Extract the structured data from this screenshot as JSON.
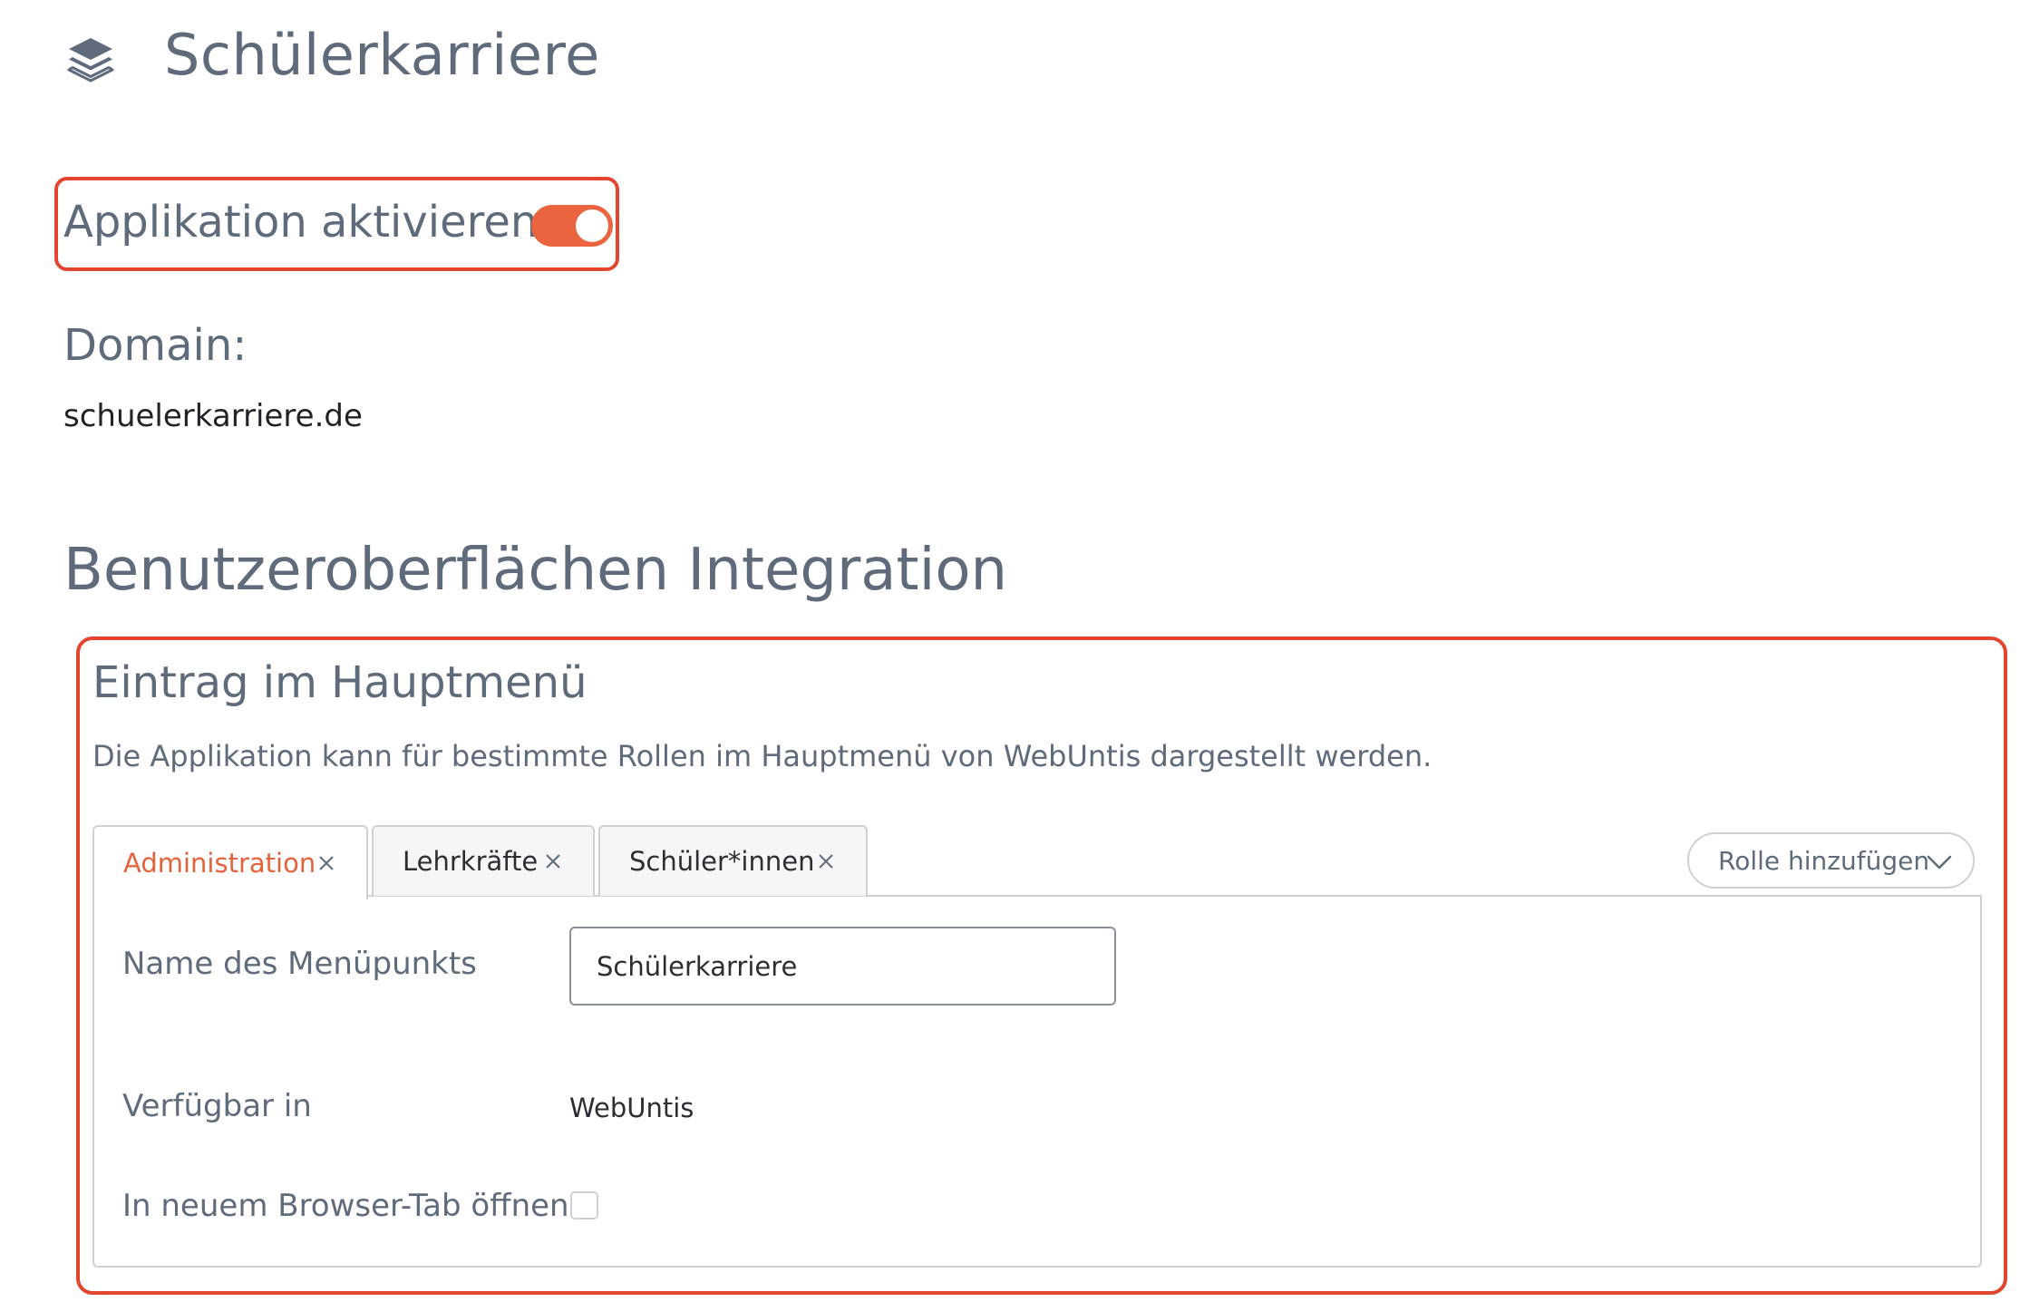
{
  "header": {
    "icon": "layers-icon",
    "title": "Schülerkarriere"
  },
  "activation": {
    "label": "Applikation aktivieren",
    "enabled": true,
    "accent_color": "#ea6440"
  },
  "domain": {
    "label": "Domain:",
    "value": "schuelerkarriere.de"
  },
  "integration": {
    "heading": "Benutzeroberflächen Integration",
    "menu_entry": {
      "title": "Eintrag im Hauptmenü",
      "description": "Die Applikation kann für bestimmte Rollen im Hauptmenü von WebUntis dargestellt werden.",
      "tabs": [
        {
          "label": "Administration",
          "active": true
        },
        {
          "label": "Lehrkräfte",
          "active": false
        },
        {
          "label": "Schüler*innen",
          "active": false
        }
      ],
      "add_role_label": "Rolle hinzufügen",
      "fields": {
        "name_label": "Name des Menüpunkts",
        "name_value": "Schülerkarriere",
        "available_label": "Verfügbar in",
        "available_value": "WebUntis",
        "new_tab_label": "In neuem Browser-Tab öffnen",
        "new_tab_checked": false
      }
    }
  },
  "colors": {
    "highlight_border": "#e4452f",
    "active_tab_text": "#e4633d",
    "text_muted": "#5f6b7a"
  }
}
